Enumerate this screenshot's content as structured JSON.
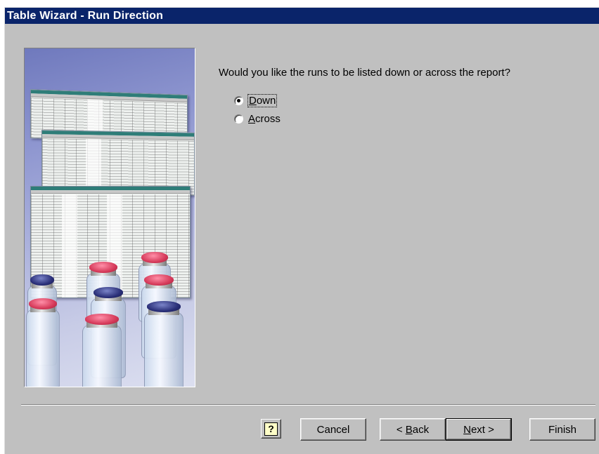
{
  "window": {
    "title": "Table Wizard - Run Direction"
  },
  "main": {
    "question": "Would you like the runs to be listed down or across the report?",
    "options": [
      {
        "label_prefix": "",
        "accel": "D",
        "label_rest": "own",
        "selected": true
      },
      {
        "label_prefix": "",
        "accel": "A",
        "label_rest": "cross",
        "selected": false
      }
    ]
  },
  "buttons": {
    "help_glyph": "?",
    "cancel": "Cancel",
    "back_prefix": "< ",
    "back_accel": "B",
    "back_rest": "ack",
    "next_accel": "N",
    "next_rest": "ext >",
    "finish": "Finish"
  },
  "icons": {
    "help": "help-icon",
    "illustration": "wizard-illustration"
  },
  "colors": {
    "titlebar": "#0a246a",
    "face": "#c0c0c0"
  }
}
